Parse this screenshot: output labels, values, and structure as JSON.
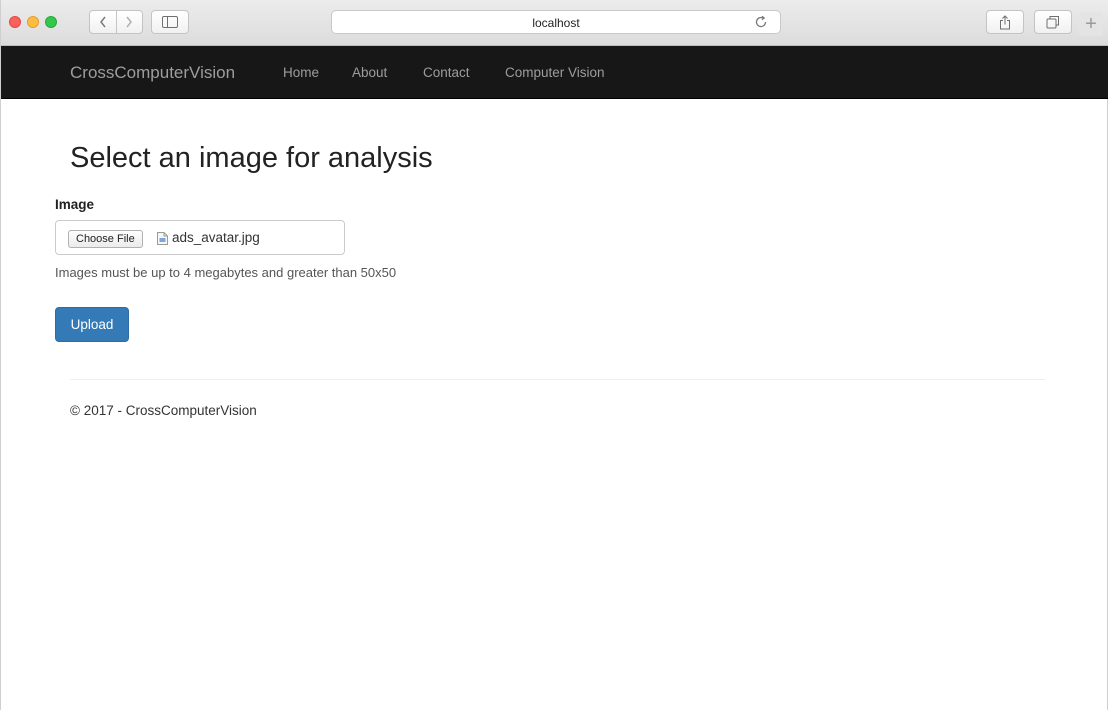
{
  "browser": {
    "address": "localhost",
    "new_tab_glyph": "+",
    "icons": {
      "back": "chevron-left-icon",
      "forward": "chevron-right-icon",
      "sidebar": "sidebar-icon",
      "reload": "reload-icon",
      "share": "share-icon",
      "tabs": "tabs-icon"
    }
  },
  "navbar": {
    "brand": "CrossComputerVision",
    "links": [
      "Home",
      "About",
      "Contact",
      "Computer Vision"
    ]
  },
  "main": {
    "title": "Select an image for analysis",
    "image_label": "Image",
    "choose_file_label": "Choose File",
    "file_name": "ads_avatar.jpg",
    "help_text": "Images must be up to 4 megabytes and greater than 50x50",
    "upload_label": "Upload"
  },
  "footer": {
    "text": "© 2017 - CrossComputerVision"
  },
  "colors": {
    "navbar_bg": "#171717",
    "navbar_text": "#9d9d9d",
    "primary_button": "#337ab7"
  }
}
